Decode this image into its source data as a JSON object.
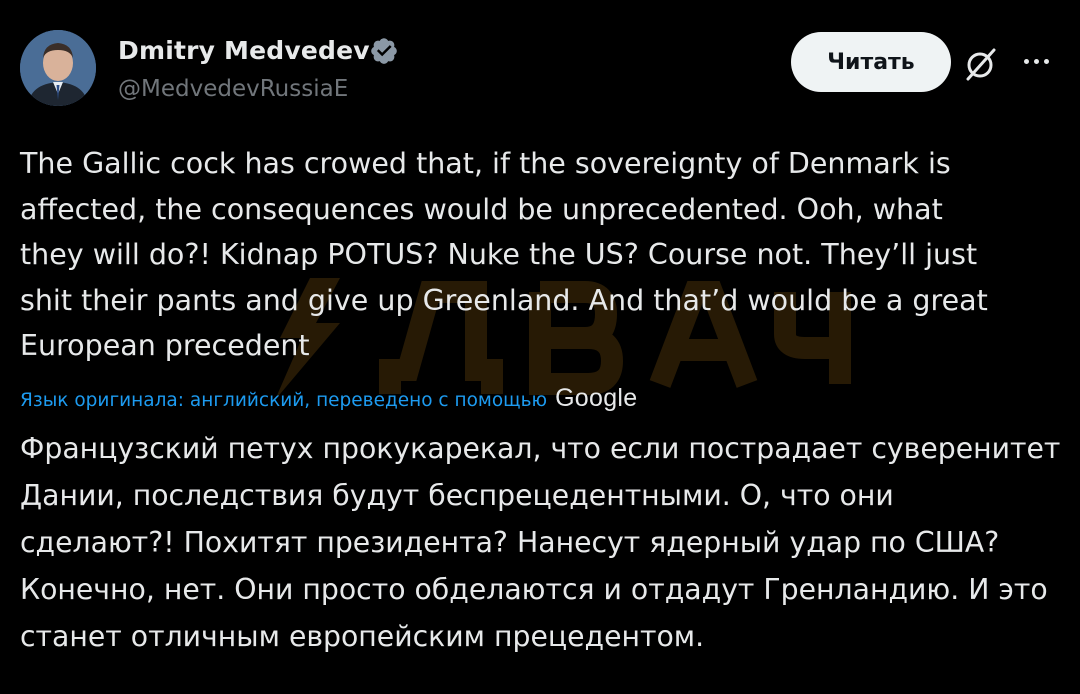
{
  "author": {
    "display_name": "Dmitry Medvedev",
    "handle": "@MedvedevRussiaE",
    "verified_icon": "verified-badge-icon",
    "avatar": "avatar"
  },
  "actions": {
    "read_label": "Читать",
    "grok_icon": "grok-slash-icon",
    "more_icon": "more-options-icon"
  },
  "tweet": {
    "text": "The Gallic cock has crowed that, if the sovereignty of Denmark is\naffected, the consequences would be unprecedented. Ooh, what\nthey will do?! Kidnap POTUS? Nuke the US? Course not. They’ll just\nshit their pants and give up Greenland. And that’d would be a great\nEuropean precedent"
  },
  "translation": {
    "note": "Язык оригинала: английский, переведено с помощью",
    "provider": "Google",
    "text": "Французский петух прокукарекал, что если пострадает суверенитет\nДании, последствия будут беспрецедентными. О, что они\nсделают?! Похитят президента? Нанесут ядерный удар по США?\nКонечно, нет. Они просто обделаются и отдадут Гренландию. И это\nстанет отличным европейским прецедентом."
  },
  "watermark": {
    "text": "Двач",
    "color": "#f0a020"
  },
  "colors": {
    "background": "#000000",
    "text": "#e7e9ea",
    "secondary_text": "#71767b",
    "link": "#1d9bf0",
    "verified": "#1d9bf0",
    "button_bg": "#eff3f4"
  }
}
